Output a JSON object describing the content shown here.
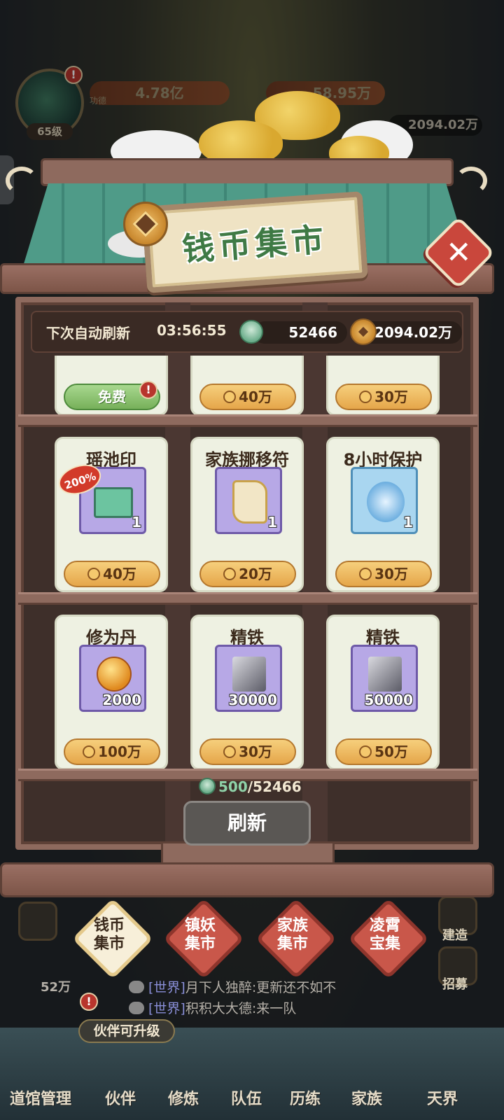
{
  "hud": {
    "level": "65级",
    "power_label": "功德",
    "power_value": "4.78亿",
    "attack_value": "58.95万",
    "top_coins": "2094.02万"
  },
  "shop": {
    "title": "钱币集市",
    "close_label": "✕",
    "refresh_label": "下次自动刷新",
    "refresh_time": "03:56:55",
    "jade_amount": "52466",
    "coin_amount": "2094.02万",
    "top_row": [
      {
        "price": "免费",
        "free": true
      },
      {
        "price": "40万"
      },
      {
        "price": "30万"
      }
    ],
    "items": [
      {
        "name": "瑶池印",
        "qty": "1",
        "price": "40万",
        "badge": "200%",
        "box": "purple"
      },
      {
        "name": "家族挪移符",
        "qty": "1",
        "price": "20万",
        "box": "purple"
      },
      {
        "name": "8小时保护",
        "qty": "1",
        "price": "30万",
        "box": "blue"
      },
      {
        "name": "修为丹",
        "qty": "2000",
        "price": "100万",
        "box": "purple"
      },
      {
        "name": "精铁",
        "qty": "30000",
        "price": "30万",
        "box": "purple"
      },
      {
        "name": "精铁",
        "qty": "50000",
        "price": "50万",
        "box": "purple"
      }
    ],
    "refresh_cost_current": "500",
    "refresh_cost_total": "/52466",
    "refresh_button": "刷新"
  },
  "tabs": [
    {
      "label": "钱币集市",
      "active": true
    },
    {
      "label": "镇妖集市"
    },
    {
      "label": "家族集市"
    },
    {
      "label": "凌霄宝集"
    }
  ],
  "chat": [
    {
      "channel": "[世界]",
      "text": "月下人独醉:更新还不如不"
    },
    {
      "channel": "[世界]",
      "text": "积积大大德:来一队"
    }
  ],
  "player_coins": "52万",
  "hint": "伙伴可升级",
  "nav": [
    "道馆管理",
    "伙伴",
    "修炼",
    "队伍",
    "历练",
    "家族",
    "天界"
  ],
  "side_labels": {
    "build": "建造",
    "recruit": "招募"
  },
  "colors": {
    "accent_green": "#3f7a45",
    "price_gold": "#e5a64a",
    "free_green": "#77b05a",
    "alert_red": "#b8352d"
  }
}
